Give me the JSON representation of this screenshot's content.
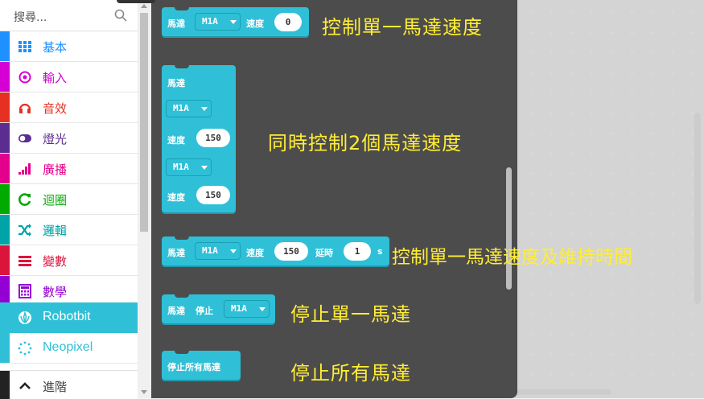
{
  "search": {
    "placeholder": "搜尋..."
  },
  "categories": [
    {
      "label": "基本",
      "icon": "grid-icon",
      "color": "#1e90ff"
    },
    {
      "label": "輸入",
      "icon": "target-icon",
      "color": "#d400d4"
    },
    {
      "label": "音效",
      "icon": "headphone-icon",
      "color": "#e63022"
    },
    {
      "label": "燈光",
      "icon": "toggle-icon",
      "color": "#5c2d91"
    },
    {
      "label": "廣播",
      "icon": "signal-icon",
      "color": "#e3008c"
    },
    {
      "label": "迴圈",
      "icon": "refresh-icon",
      "color": "#00aa00"
    },
    {
      "label": "邏輯",
      "icon": "shuffle-icon",
      "color": "#00a4a6"
    },
    {
      "label": "變數",
      "icon": "lines-icon",
      "color": "#dc143c"
    },
    {
      "label": "數學",
      "icon": "calculator-icon",
      "color": "#9400d3"
    },
    {
      "label": "Robotbit",
      "icon": "rebel-icon",
      "color": "#2fc0d7"
    },
    {
      "label": "Neopixel",
      "icon": "dots-ring-icon",
      "color": "#2fc0d7"
    },
    {
      "label": "進階",
      "icon": "chevron-up-icon",
      "color": "#222222"
    }
  ],
  "blocks": {
    "b1": {
      "motor": "馬達",
      "port": "M1A",
      "speed_label": "速度",
      "speed": "0"
    },
    "b2": {
      "title": "馬達",
      "port1": "M1A",
      "speed_label1": "速度",
      "speed1": "150",
      "port2": "M1A",
      "speed_label2": "速度",
      "speed2": "150"
    },
    "b3": {
      "motor": "馬達",
      "port": "M1A",
      "speed_label": "速度",
      "speed": "150",
      "delay_label": "延時",
      "delay": "1",
      "unit": "s"
    },
    "b4": {
      "motor": "馬達",
      "stop": "停止",
      "port": "M1A"
    },
    "b5": {
      "label": "停止所有馬達"
    }
  },
  "annotations": {
    "a1": "控制單一馬達速度",
    "a2": "同時控制2個馬達速度",
    "a3": "控制單一馬達速度及維持時間",
    "a4": "停止單一馬達",
    "a5": "停止所有馬達"
  },
  "colors": {
    "accent": "#2fc0d7",
    "flyout": "#4d4c4c",
    "annotation": "#ffee33"
  }
}
